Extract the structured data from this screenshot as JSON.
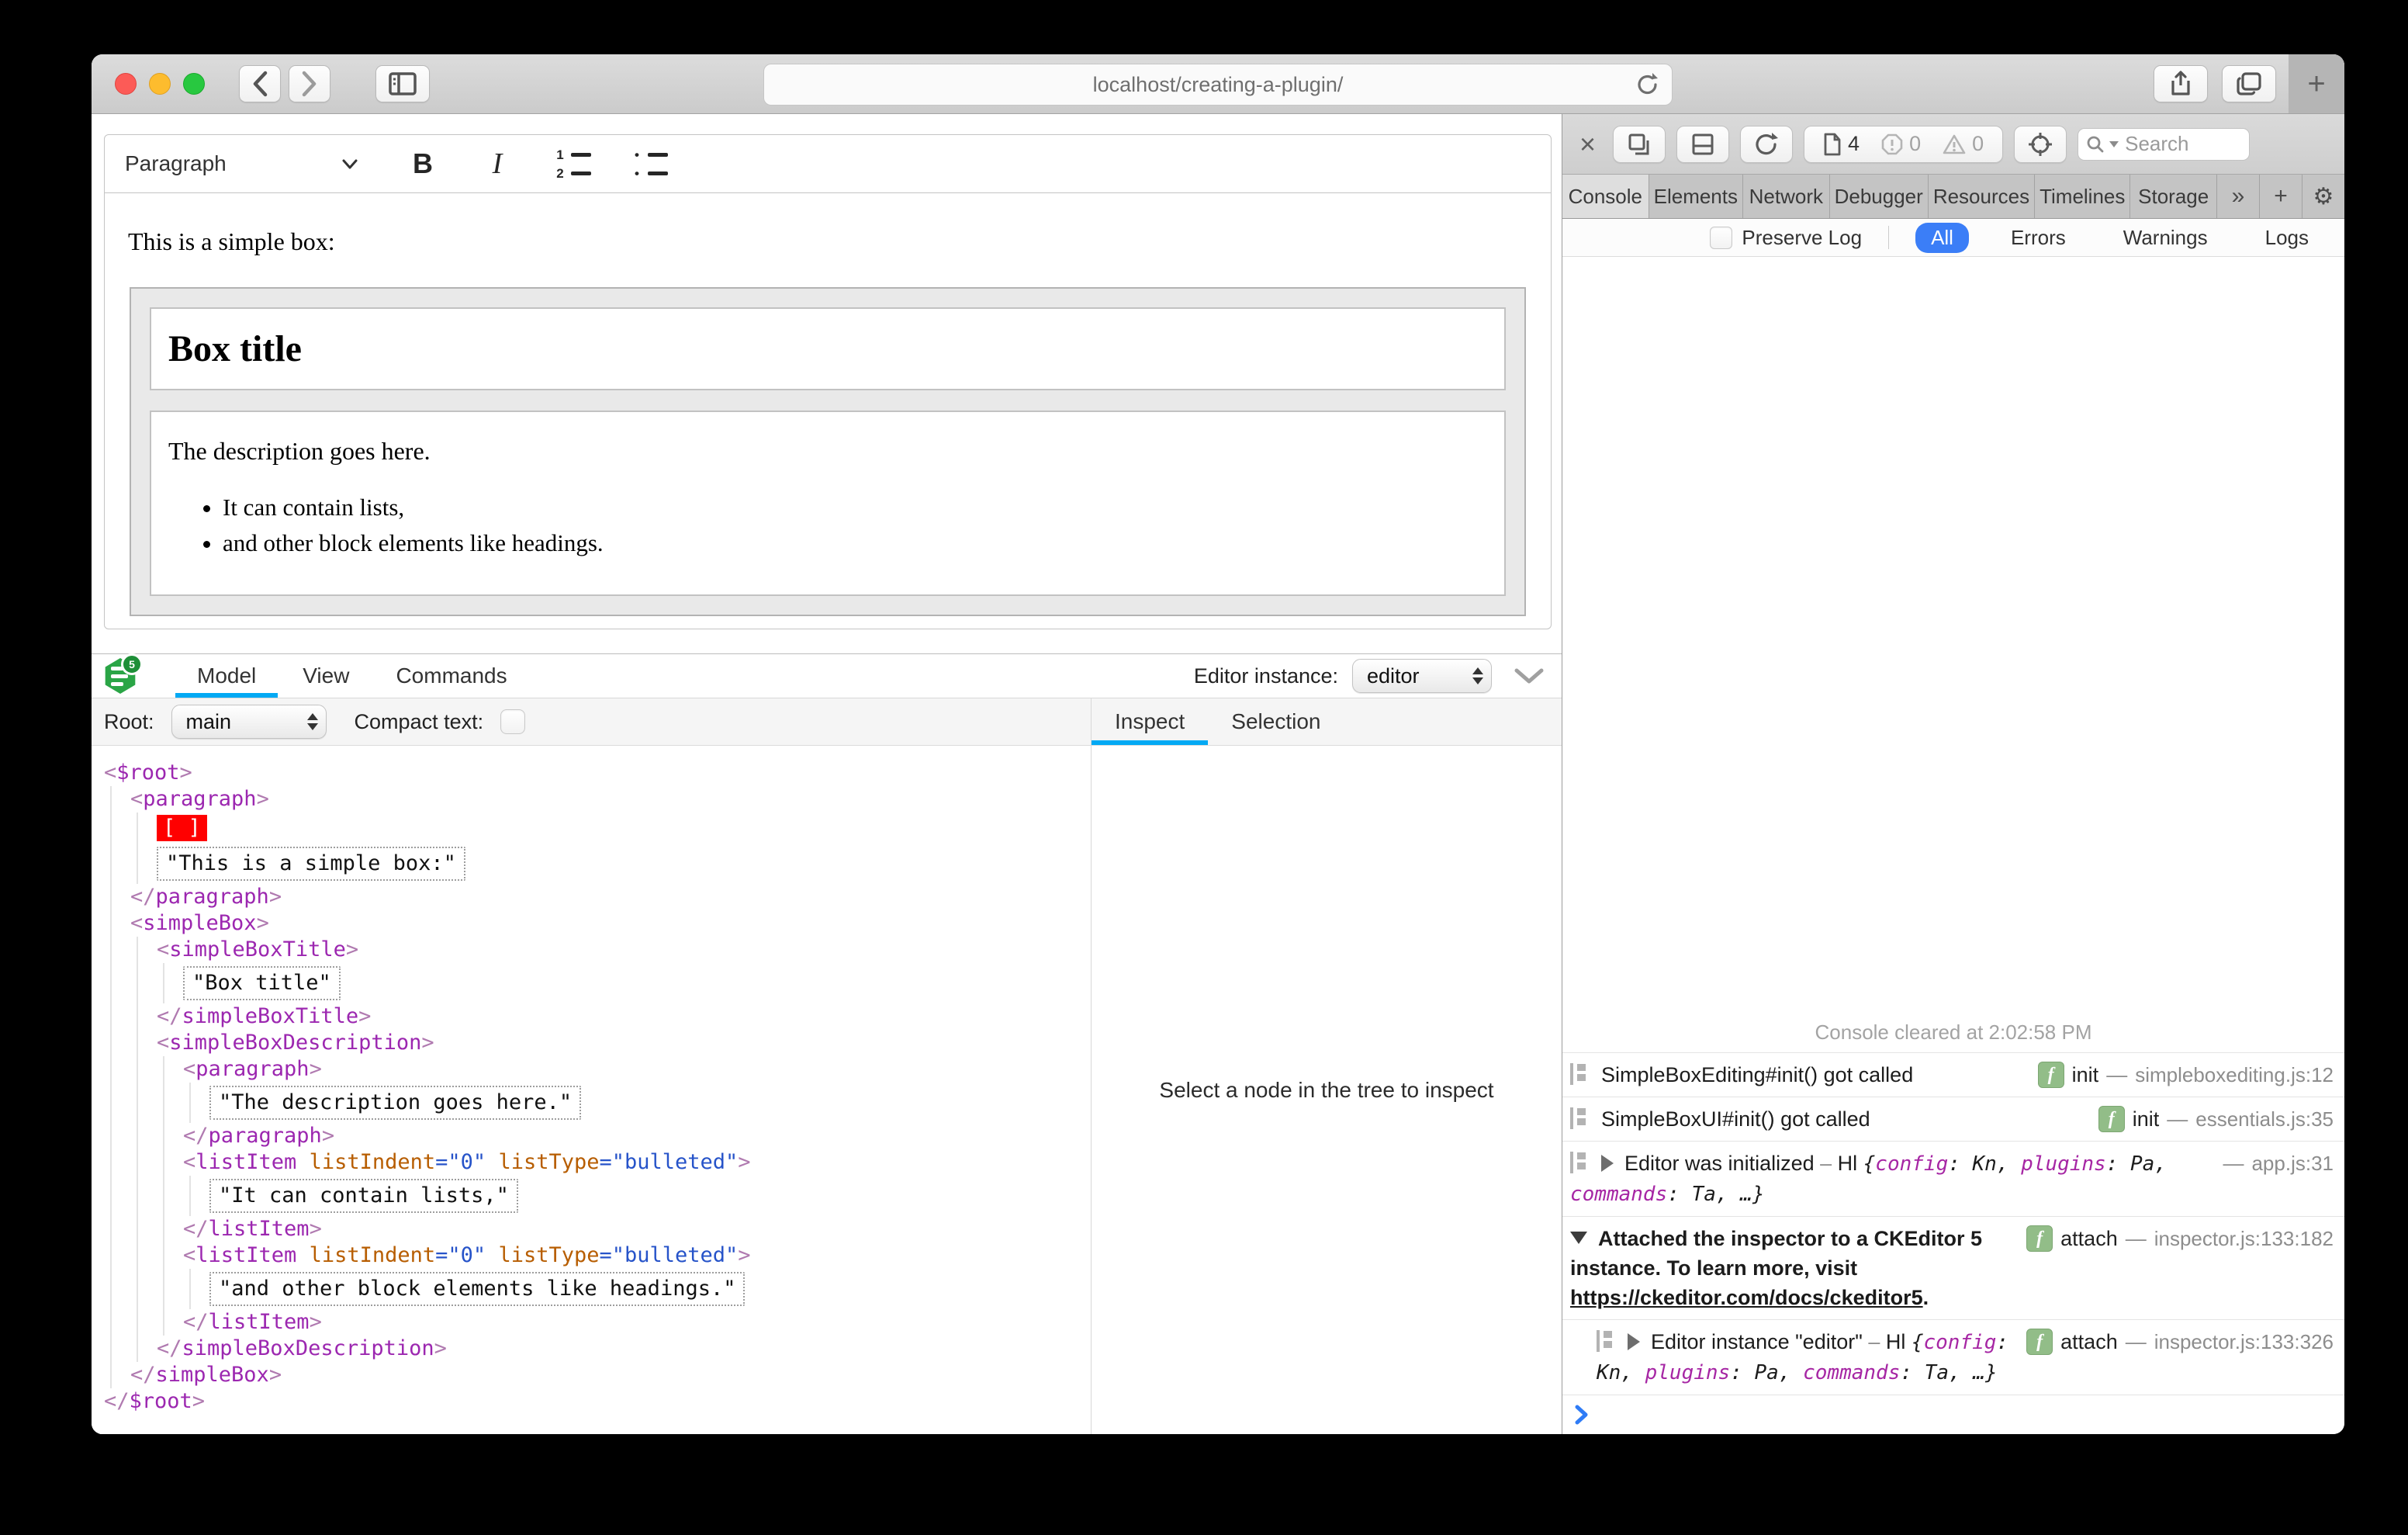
{
  "browser": {
    "url": "localhost/creating-a-plugin/",
    "window_controls": [
      "close",
      "minimize",
      "zoom"
    ],
    "toolbar_icons": [
      "back",
      "forward",
      "sidebar",
      "reload",
      "share",
      "tabs",
      "new-tab"
    ]
  },
  "editor": {
    "toolbar": {
      "heading_dropdown": "Paragraph",
      "buttons": [
        "bold",
        "italic",
        "numbered-list",
        "bulleted-list"
      ]
    },
    "content": {
      "intro": "This is a simple box:",
      "box_title": "Box title",
      "description": "The description goes here.",
      "list_items": [
        "It can contain lists,",
        "and other block elements like headings."
      ]
    }
  },
  "inspector": {
    "tabs": [
      {
        "label": "Model",
        "active": true
      },
      {
        "label": "View",
        "active": false
      },
      {
        "label": "Commands",
        "active": false
      }
    ],
    "editor_instance_label": "Editor instance:",
    "editor_instance_value": "editor",
    "root_label": "Root:",
    "root_value": "main",
    "compact_text_label": "Compact text:",
    "side_tabs": [
      {
        "label": "Inspect",
        "active": true
      },
      {
        "label": "Selection",
        "active": false
      }
    ],
    "empty_message": "Select a node in the tree to inspect",
    "tree_lines": [
      {
        "indent": 0,
        "kind": "open",
        "name": "$root"
      },
      {
        "indent": 1,
        "kind": "open",
        "name": "paragraph"
      },
      {
        "indent": 2,
        "kind": "selection",
        "text": "[ ]"
      },
      {
        "indent": 2,
        "kind": "text",
        "text": "\"This is a simple box:\""
      },
      {
        "indent": 1,
        "kind": "close",
        "name": "paragraph"
      },
      {
        "indent": 1,
        "kind": "open",
        "name": "simpleBox"
      },
      {
        "indent": 2,
        "kind": "open",
        "name": "simpleBoxTitle"
      },
      {
        "indent": 3,
        "kind": "text",
        "text": "\"Box title\""
      },
      {
        "indent": 2,
        "kind": "close",
        "name": "simpleBoxTitle"
      },
      {
        "indent": 2,
        "kind": "open",
        "name": "simpleBoxDescription"
      },
      {
        "indent": 3,
        "kind": "open",
        "name": "paragraph"
      },
      {
        "indent": 4,
        "kind": "text",
        "text": "\"The description goes here.\""
      },
      {
        "indent": 3,
        "kind": "close",
        "name": "paragraph"
      },
      {
        "indent": 3,
        "kind": "open",
        "name": "listItem",
        "attrs": [
          {
            "name": "listIndent",
            "value": "0"
          },
          {
            "name": "listType",
            "value": "bulleted"
          }
        ]
      },
      {
        "indent": 4,
        "kind": "text",
        "text": "\"It can contain lists,\""
      },
      {
        "indent": 3,
        "kind": "close",
        "name": "listItem"
      },
      {
        "indent": 3,
        "kind": "open",
        "name": "listItem",
        "attrs": [
          {
            "name": "listIndent",
            "value": "0"
          },
          {
            "name": "listType",
            "value": "bulleted"
          }
        ]
      },
      {
        "indent": 4,
        "kind": "text",
        "text": "\"and other block elements like headings.\""
      },
      {
        "indent": 3,
        "kind": "close",
        "name": "listItem"
      },
      {
        "indent": 2,
        "kind": "close",
        "name": "simpleBoxDescription"
      },
      {
        "indent": 1,
        "kind": "close",
        "name": "simpleBox"
      },
      {
        "indent": 0,
        "kind": "close",
        "name": "$root"
      }
    ]
  },
  "devtools": {
    "toolbar": {
      "icons": [
        "close",
        "dock-window",
        "dock-bottom",
        "reload",
        "element-picker",
        "search"
      ],
      "page_count": "4",
      "error_count": "0",
      "warning_count": "0",
      "search_placeholder": "Search"
    },
    "tabs": [
      {
        "label": "Console",
        "active": true
      },
      {
        "label": "Elements",
        "active": false
      },
      {
        "label": "Network",
        "active": false
      },
      {
        "label": "Debugger",
        "active": false
      },
      {
        "label": "Resources",
        "active": false
      },
      {
        "label": "Timelines",
        "active": false
      },
      {
        "label": "Storage",
        "active": false
      }
    ],
    "overflow_icons": [
      "more-tabs",
      "add-tab",
      "settings"
    ],
    "filter": {
      "preserve_log_label": "Preserve Log",
      "options": [
        {
          "label": "All",
          "active": true
        },
        {
          "label": "Errors",
          "active": false
        },
        {
          "label": "Warnings",
          "active": false
        },
        {
          "label": "Logs",
          "active": false
        }
      ]
    },
    "console": {
      "cleared": "Console cleared at 2:02:58 PM",
      "object_preview": {
        "dash": "–",
        "ref": "Hl",
        "open": "{",
        "pairs": [
          [
            "config",
            "Kn"
          ],
          [
            "plugins",
            "Pa"
          ],
          [
            "commands",
            "Ta"
          ]
        ],
        "close": ", …}"
      },
      "messages": [
        {
          "icon": true,
          "text": "SimpleBoxEditing#init() got called",
          "badge": "init",
          "source": "simpleboxediting.js:12"
        },
        {
          "icon": true,
          "text": "SimpleBoxUI#init() got called",
          "badge": "init",
          "source": "essentials.js:35"
        },
        {
          "icon": true,
          "arrow": "right",
          "text": "Editor was initialized",
          "object": true,
          "source": "app.js:31"
        },
        {
          "arrow": "down",
          "bold": true,
          "text": "Attached the inspector to a CKEditor 5 instance. To learn more, visit",
          "link": "https://ckeditor.com/docs/ckeditor5",
          "suffix": ".",
          "badge": "attach",
          "source": "inspector.js:133:182"
        },
        {
          "icon": true,
          "arrow": "right",
          "nested": true,
          "text": "Editor instance \"editor\"",
          "object": true,
          "badge": "attach",
          "source": "inspector.js:133:326"
        }
      ]
    }
  },
  "colors": {
    "accent_blue_underline": "#03a9f4",
    "filter_pill_blue": "#3b7ef7",
    "selection_red": "#ff0000",
    "tag_purple": "#9c27b0",
    "attr_orange": "#b75d00",
    "value_blue": "#2653c9",
    "badge_green": "#92bd88",
    "prompt_blue": "#2f7cf6"
  }
}
